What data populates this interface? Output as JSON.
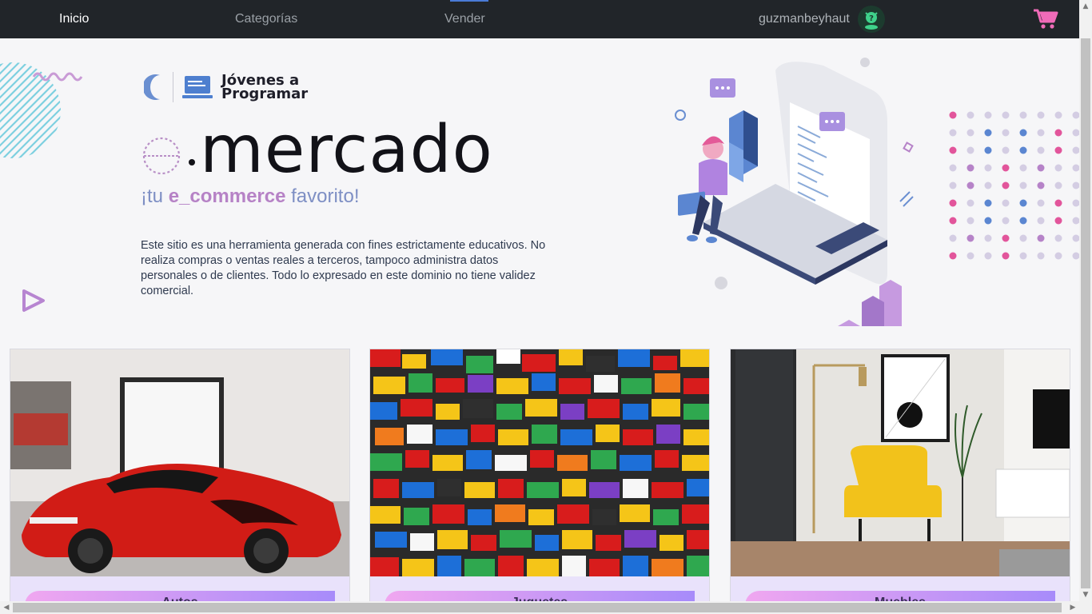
{
  "nav": {
    "links": [
      "Inicio",
      "Categorías",
      "Vender"
    ],
    "username": "guzmanbeyhaut",
    "icons": {
      "avatar": "avatar-icon",
      "cart": "cart-icon"
    }
  },
  "hero": {
    "brand_line1": "Jóvenes a",
    "brand_line2": "Programar",
    "title": "mercado",
    "tagline_pre": "¡tu ",
    "tagline_bold": "e_commerce",
    "tagline_post": " favorito!",
    "disclaimer": "Este sitio es una herramienta generada con fines estrictamente educativos. No realiza compras o ventas reales a terceros, tampoco administra datos personales o de clientes. Todo lo expresado en este dominio no tiene validez comercial."
  },
  "cards": [
    {
      "label": "Autos",
      "image": "red-sports-car-photo"
    },
    {
      "label": "Juguetes",
      "image": "lego-bricks-photo"
    },
    {
      "label": "Muebles",
      "image": "yellow-armchair-room-photo"
    }
  ],
  "colors": {
    "navbar": "#212529",
    "accent_purple": "#b682c6",
    "accent_blue": "#7e8fc4",
    "cart_pink": "#f06bb8",
    "card_bg": "#e9e2fb"
  }
}
